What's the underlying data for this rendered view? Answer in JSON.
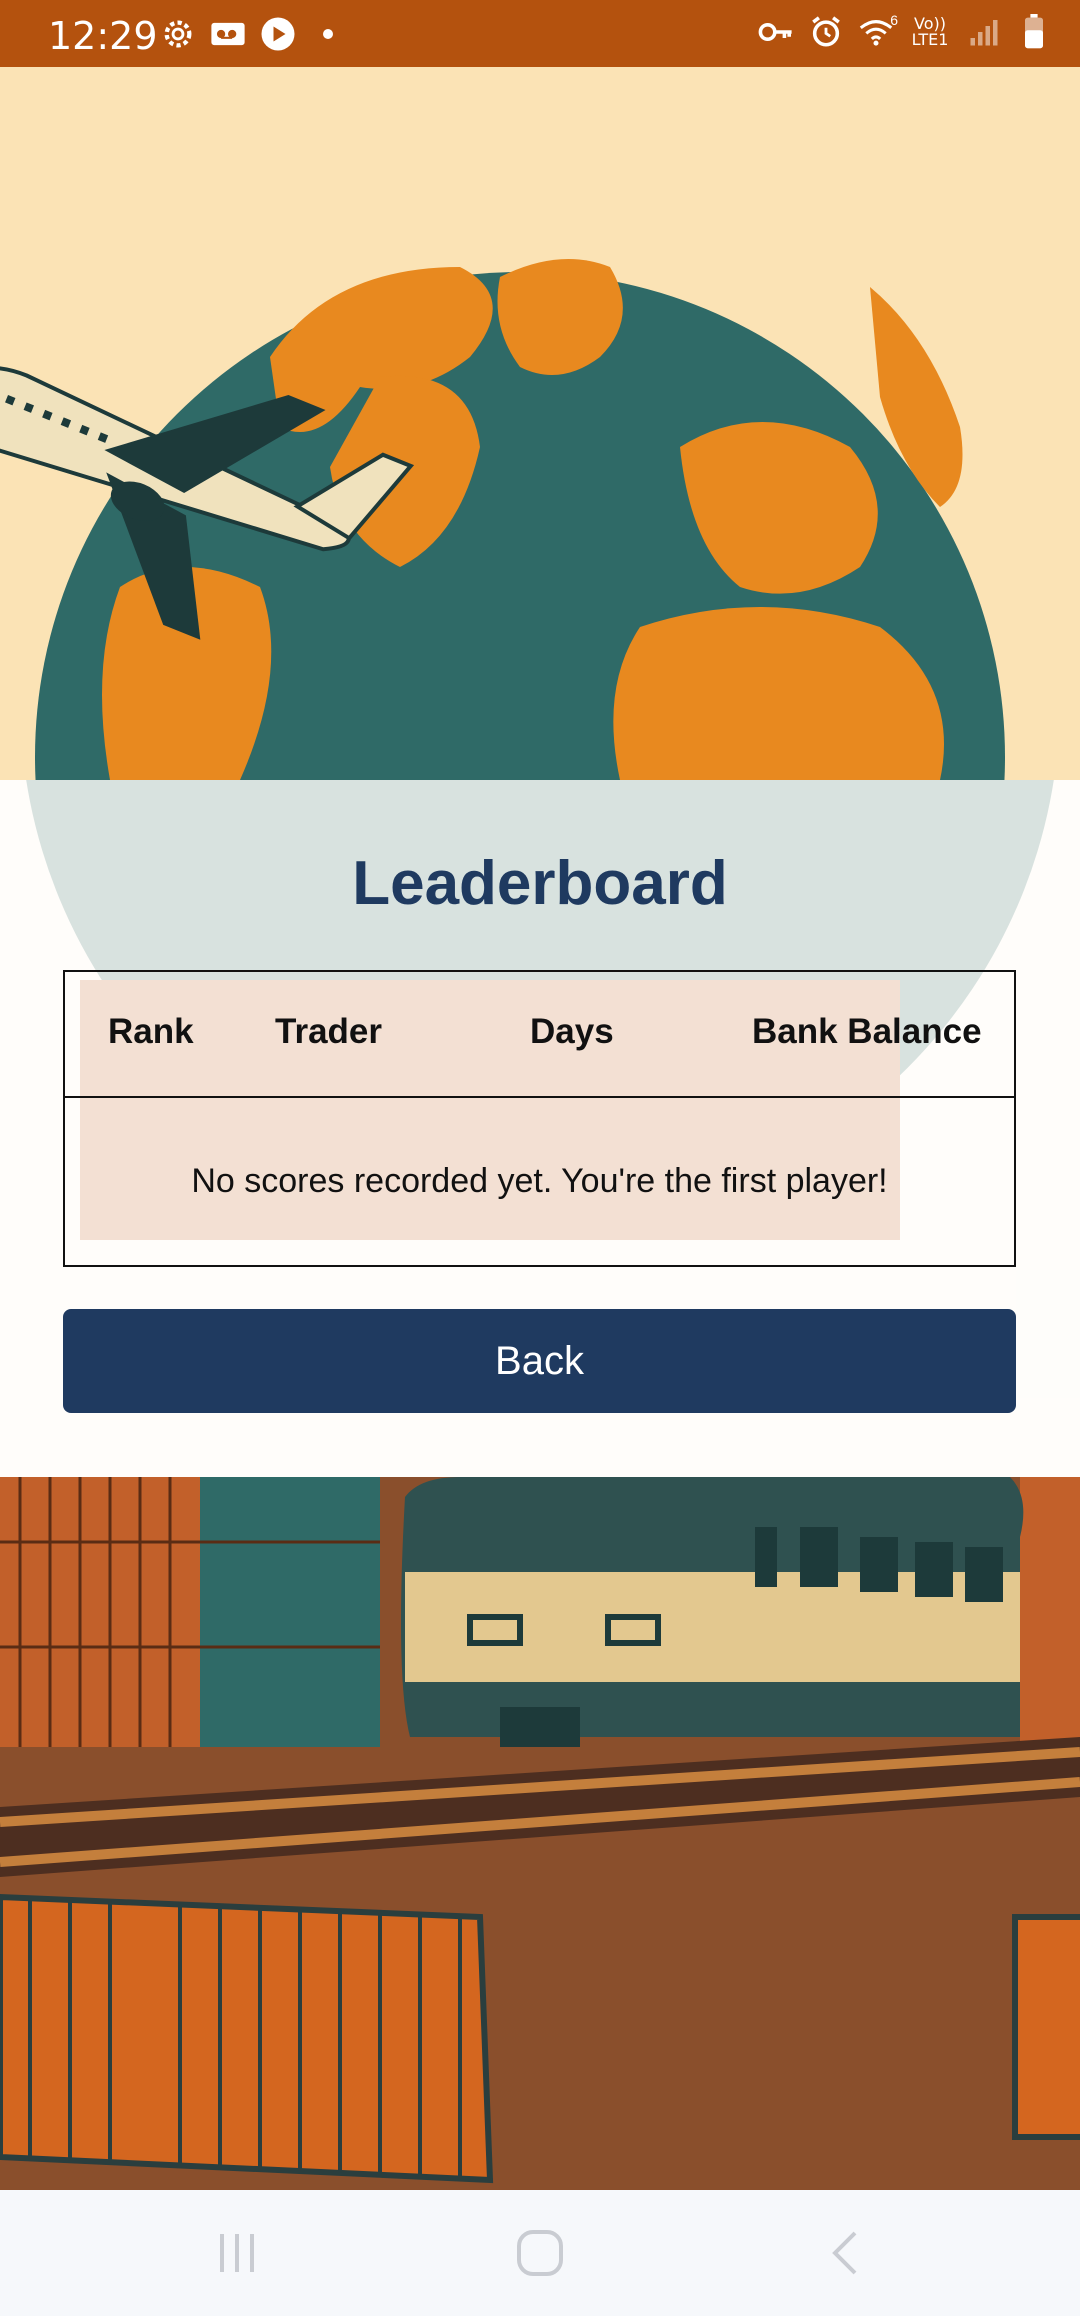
{
  "status_bar": {
    "time": "12:29",
    "left_icons": [
      "gear-icon",
      "voicemail-icon",
      "play-icon",
      "dot-icon"
    ],
    "right_icons": [
      "key-icon",
      "alarm-icon",
      "wifi-icon",
      "lte-icon",
      "signal-icon",
      "battery-icon"
    ],
    "lte_top": "Vo))",
    "lte_bottom": "LTE1",
    "wifi_badge": "6"
  },
  "leaderboard": {
    "title": "Leaderboard",
    "columns": [
      "Rank",
      "Trader",
      "Days",
      "Bank Balance"
    ],
    "empty_message": "No scores recorded yet. You're the first player!"
  },
  "actions": {
    "back_label": "Back"
  },
  "nav_bar": {
    "buttons": [
      "recents-icon",
      "home-icon",
      "back-icon"
    ]
  },
  "colors": {
    "status_bar": "#b4520e",
    "title": "#1f3a60",
    "button": "#1f3a60",
    "globe_ocean": "#2f6a67",
    "globe_land": "#e8891f",
    "sky": "#fbe3b5"
  }
}
